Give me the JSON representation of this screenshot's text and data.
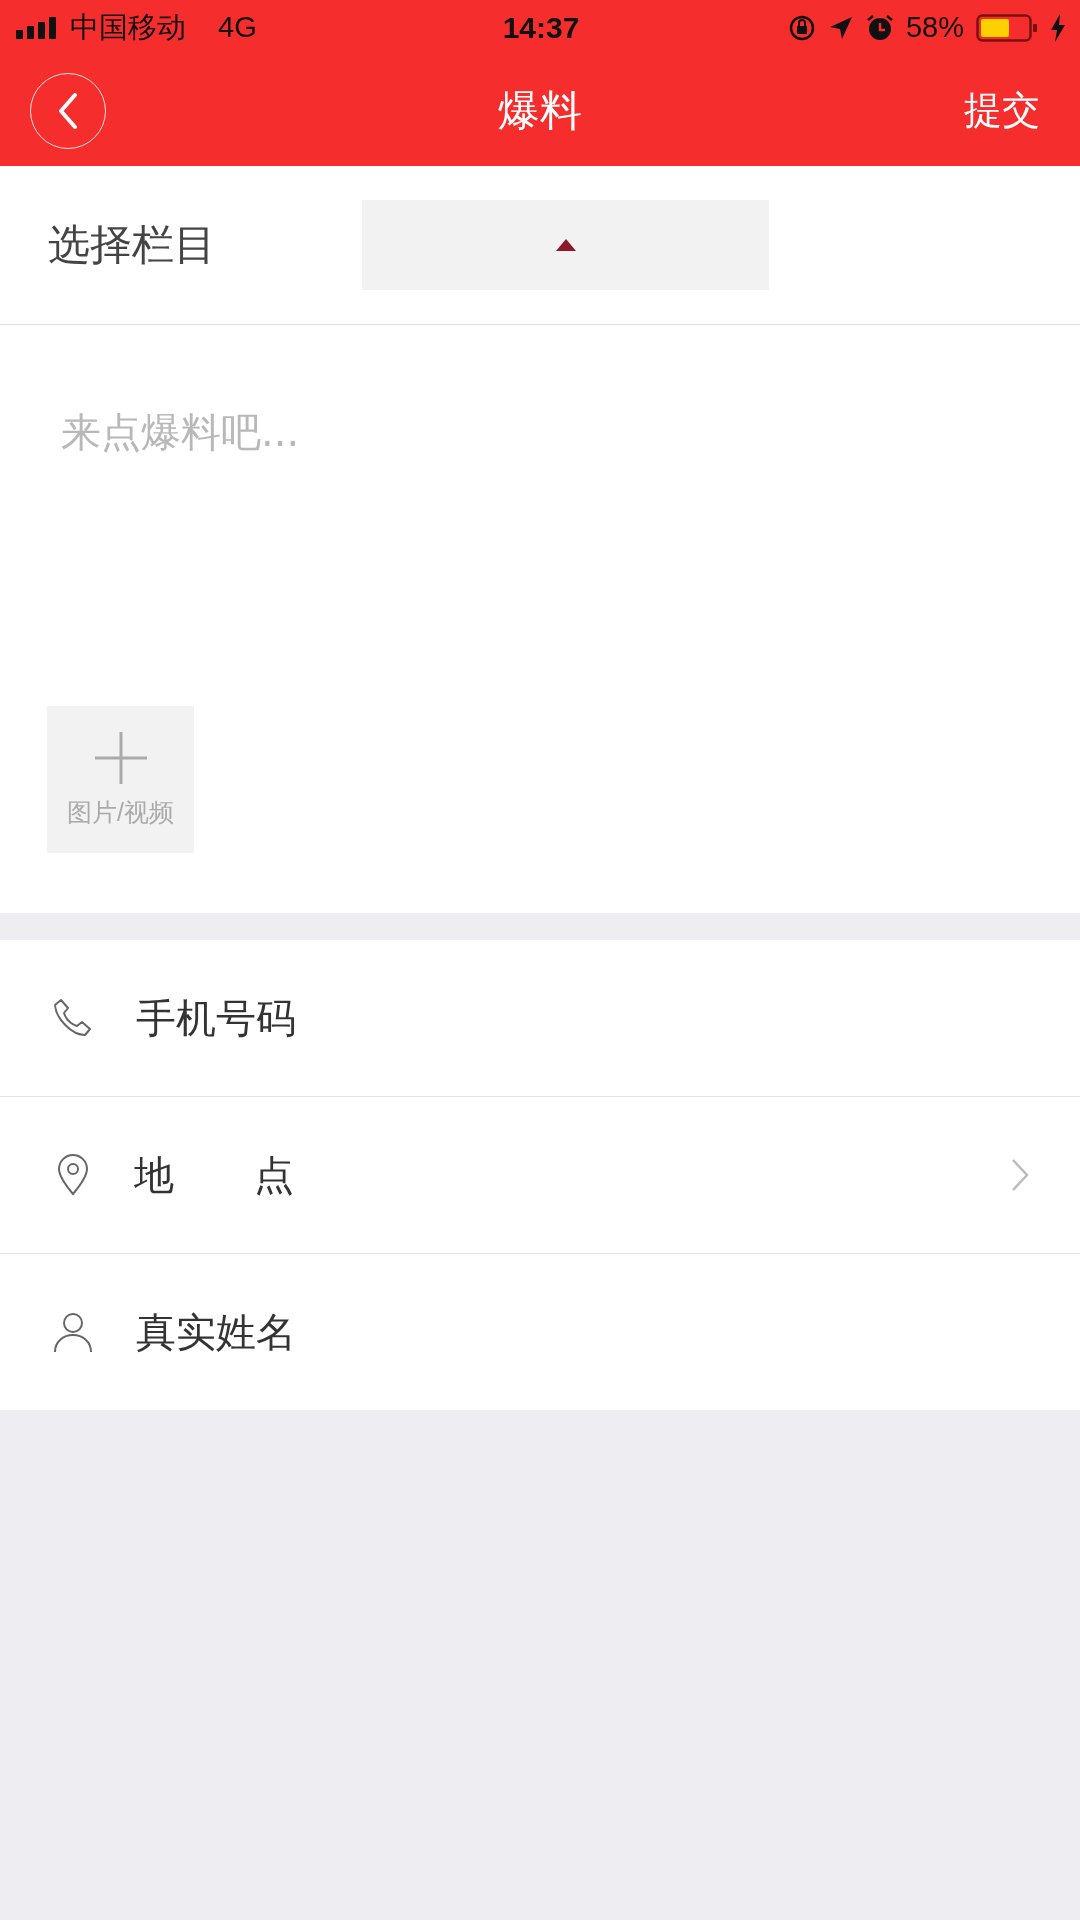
{
  "status_bar": {
    "carrier": "中国移动",
    "network": "4G",
    "time": "14:37",
    "battery": "58%"
  },
  "header": {
    "title": "爆料",
    "action": "提交"
  },
  "column_select": {
    "label": "选择栏目",
    "expanded": true
  },
  "report": {
    "placeholder": "来点爆料吧...",
    "add_media": "图片/视频"
  },
  "fields": [
    {
      "kind": "phone",
      "placeholder": "手机号码",
      "chevron": false
    },
    {
      "kind": "location",
      "label": "地　　点",
      "chevron": true
    },
    {
      "kind": "person",
      "placeholder": "真实姓名",
      "chevron": false
    }
  ]
}
